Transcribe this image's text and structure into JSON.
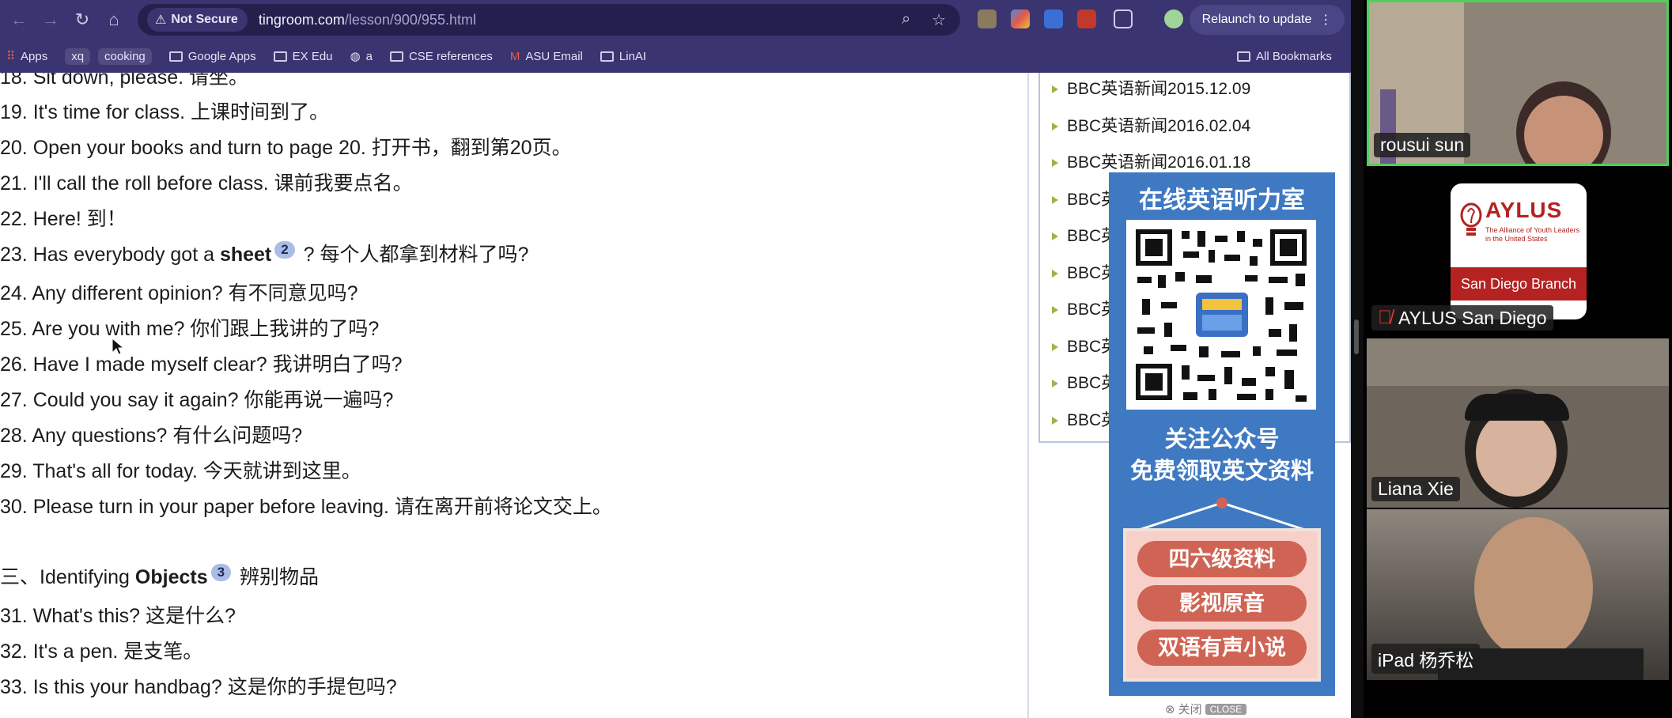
{
  "browser": {
    "security_label": "Not Secure",
    "url_host": "tingroom.com",
    "url_path": "/lesson/900/955.html",
    "relaunch_label": "Relaunch to update",
    "bookmarks": [
      "Apps",
      "xq",
      "cooking",
      "Google Apps",
      "EX Edu",
      "a",
      "CSE references",
      "ASU Email",
      "LinAI"
    ],
    "all_bookmarks": "All Bookmarks"
  },
  "lesson": {
    "partial_top": "18. Sit down, please. 请坐。",
    "items": [
      "19. It's time for class. 上课时间到了。",
      "20. Open your books and turn to page 20. 打开书，翻到第20页。",
      "21. I'll call the roll before class. 课前我要点名。",
      "22. Here! 到！"
    ],
    "item23_pre": "23. Has everybody got a ",
    "item23_bold": "sheet",
    "item23_badge": "2",
    "item23_post": " ? 每个人都拿到材料了吗?",
    "items_b": [
      "24. Any different opinion? 有不同意见吗?",
      "25. Are you with me? 你们跟上我讲的了吗?",
      "26. Have I made myself clear? 我讲明白了吗?",
      "27. Could you say it again? 你能再说一遍吗?",
      "28. Any questions? 有什么问题吗?",
      "29. That's all for today. 今天就讲到这里。",
      "30. Please turn in your paper before leaving. 请在离开前将论文交上。"
    ],
    "section_pre": "三、Identifying ",
    "section_bold": "Objects",
    "section_badge": "3",
    "section_post": "辨别物品",
    "items_c": [
      "31. What's this? 这是什么?",
      "32. It's a pen. 是支笔。",
      "33. Is this your handbag? 这是你的手提包吗?"
    ]
  },
  "sidebar": {
    "news": [
      "BBC英语新闻2015.12.09",
      "BBC英语新闻2016.02.04",
      "BBC英语新闻2016.01.18",
      "BBC英",
      "BBC英",
      "BBC英",
      "BBC英",
      "BBC英",
      "BBC英",
      "BBC英"
    ]
  },
  "ad": {
    "title": "在线英语听力室",
    "follow_line1": "关注公众号",
    "follow_line2": "免费领取英文资料",
    "pills": [
      "四六级资料",
      "影视原音",
      "双语有声小说"
    ],
    "close_cn": "关闭",
    "close_en": "CLOSE"
  },
  "meeting": {
    "participants": [
      {
        "name": "rousui sun"
      },
      {
        "name": "AYLUS San Diego",
        "muted": true
      },
      {
        "name": "Liana Xie"
      },
      {
        "name": "iPad 杨乔松"
      }
    ],
    "aylus_logo": {
      "big": "AYLUS",
      "tagline": "The Alliance of Youth Leaders in the United States",
      "branch": "San Diego Branch"
    }
  },
  "colors": {
    "browser_chrome": "#3a3470",
    "ad_blue": "#3f79c2",
    "ad_pill": "#d06454",
    "active_speaker": "#4fcf5a",
    "aylus_red": "#b52222"
  }
}
